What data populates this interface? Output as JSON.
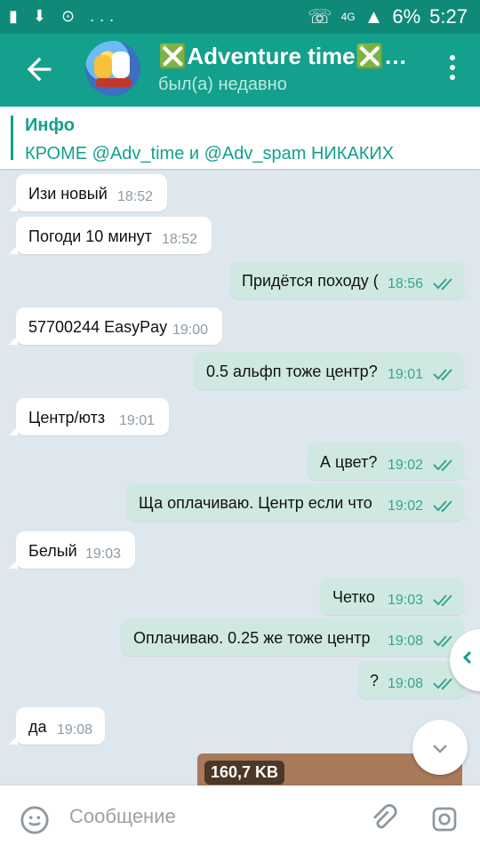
{
  "status": {
    "left_icons": "▮ ⬇ ⊙ ...",
    "signal": "4G",
    "battery": "6%",
    "time": "5:27"
  },
  "header": {
    "title": "❎Adventure time❎…",
    "subtitle": "был(а) недавно"
  },
  "pinned": {
    "title": "Инфо",
    "text": "КРОМЕ @Adv_time и @Adv_spam НИКАКИХ"
  },
  "messages": [
    {
      "dir": "in",
      "text": "Изи новый",
      "time": "18:52"
    },
    {
      "dir": "in",
      "text": "Погоди 10 минут",
      "time": "18:52"
    },
    {
      "dir": "out",
      "text": "Придётся походу (",
      "time": "18:56"
    },
    {
      "dir": "in",
      "text": "57700244 EasyPay",
      "time": "19:00"
    },
    {
      "dir": "out",
      "text": "0.5 альфп тоже центр?",
      "time": "19:01"
    },
    {
      "dir": "in",
      "text": "Центр/ютз",
      "time": "19:01"
    },
    {
      "dir": "out",
      "text": "А цвет?",
      "time": "19:02"
    },
    {
      "dir": "out",
      "text": "Ща оплачиваю.  Центр если что",
      "time": "19:02"
    },
    {
      "dir": "in",
      "text": "Белый",
      "time": "19:03"
    },
    {
      "dir": "out",
      "text": "Четко",
      "time": "19:03"
    },
    {
      "dir": "out",
      "text": "Оплачиваю.  0.25 же тоже центр",
      "time": "19:08"
    },
    {
      "dir": "out",
      "text": "?",
      "time": "19:08"
    },
    {
      "dir": "in",
      "text": "да",
      "time": "19:08"
    }
  ],
  "file": {
    "size": "160,7 KB"
  },
  "input": {
    "placeholder": "Сообщение"
  },
  "colors": {
    "header": "#13a08c",
    "outgoing": "#cfe9e2",
    "incoming": "#ffffff",
    "background": "#dfe7ee"
  }
}
